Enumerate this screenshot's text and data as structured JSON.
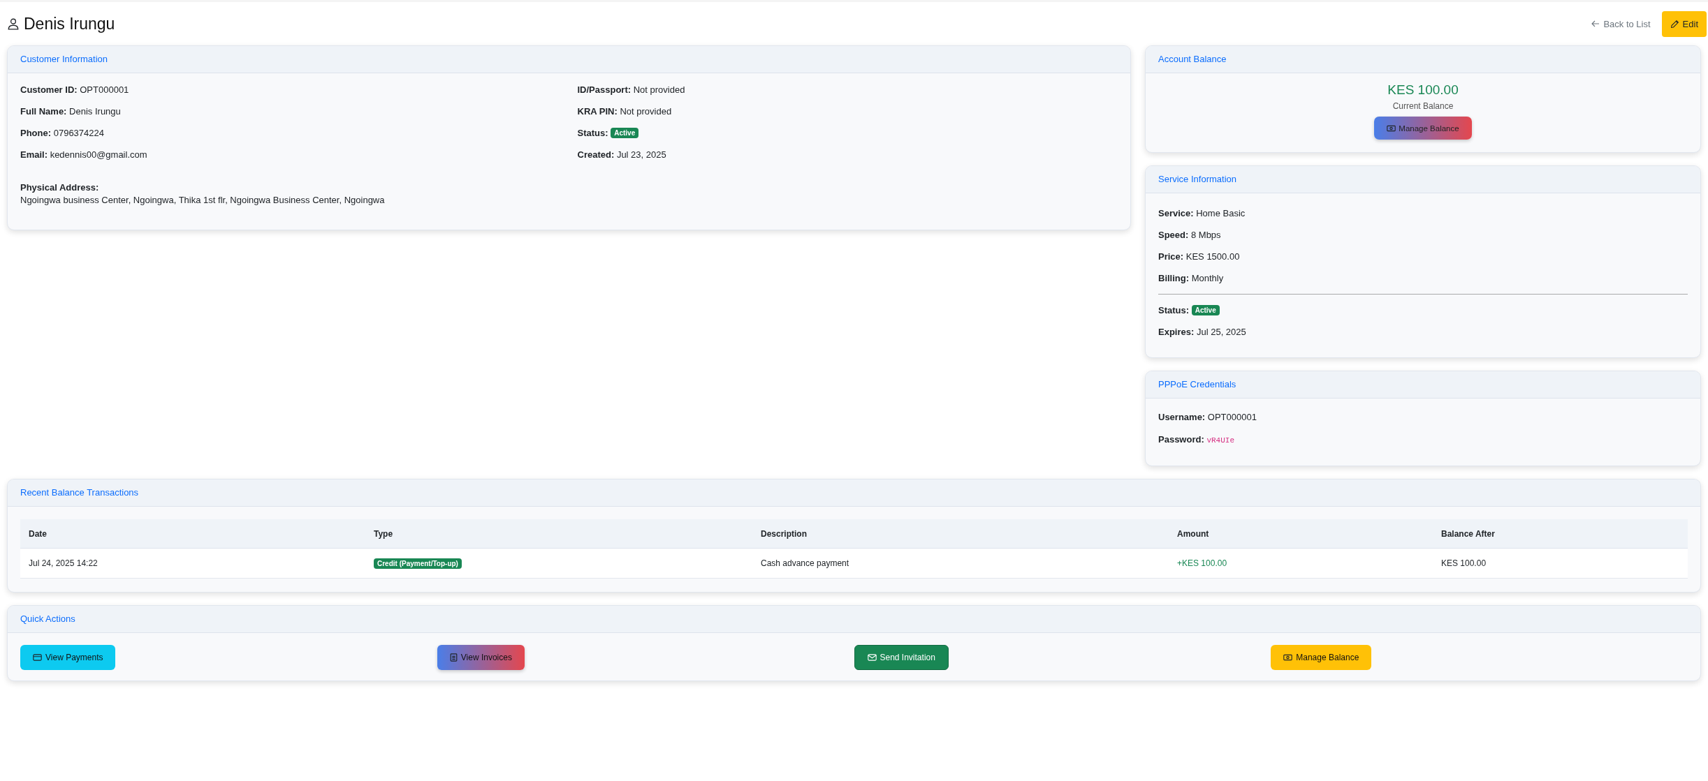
{
  "header": {
    "title": "Denis Irungu",
    "back_link": "Back to List",
    "edit_button": "Edit"
  },
  "customer_information": {
    "title": "Customer Information",
    "left_fields": [
      {
        "label": "Customer ID:",
        "value": "OPT000001",
        "kind": "text"
      },
      {
        "label": "Full Name:",
        "value": "Denis Irungu",
        "kind": "text"
      },
      {
        "label": "Phone:",
        "value": "0796374224",
        "kind": "text"
      },
      {
        "label": "Email:",
        "value": "kedennis00@gmail.com",
        "kind": "text"
      }
    ],
    "right_fields": [
      {
        "label": "ID/Passport:",
        "value": "Not provided",
        "kind": "text"
      },
      {
        "label": "KRA PIN:",
        "value": "Not provided",
        "kind": "text"
      },
      {
        "label": "Status:",
        "value": "Active",
        "kind": "badge"
      },
      {
        "label": "Created:",
        "value": "Jul 23, 2025",
        "kind": "text"
      }
    ],
    "address_label": "Physical Address:",
    "address": "Ngoingwa business Center, Ngoingwa, Thika 1st flr, Ngoingwa Business Center, Ngoingwa"
  },
  "account_balance": {
    "title": "Account Balance",
    "amount": "KES 100.00",
    "caption": "Current Balance",
    "button": "Manage Balance"
  },
  "service_information": {
    "title": "Service Information",
    "fields": [
      {
        "label": "Service:",
        "value": "Home Basic",
        "kind": "text"
      },
      {
        "label": "Speed:",
        "value": "8 Mbps",
        "kind": "text"
      },
      {
        "label": "Price:",
        "value": "KES 1500.00",
        "kind": "text"
      },
      {
        "label": "Billing:",
        "value": "Monthly",
        "kind": "text"
      }
    ],
    "status_fields": [
      {
        "label": "Status:",
        "value": "Active",
        "kind": "badge"
      },
      {
        "label": "Expires:",
        "value": "Jul 25, 2025",
        "kind": "text"
      }
    ]
  },
  "pppoe_credentials": {
    "title": "PPPoE Credentials",
    "fields": [
      {
        "label": "Username:",
        "value": "OPT000001",
        "kind": "text"
      },
      {
        "label": "Password:",
        "value": "vR4UIe",
        "kind": "code"
      }
    ]
  },
  "recent_balance_transactions": {
    "title": "Recent Balance Transactions",
    "columns": [
      "Date",
      "Type",
      "Description",
      "Amount",
      "Balance After"
    ],
    "rows": [
      [
        {
          "text": "Jul 24, 2025 14:22",
          "kind": "text"
        },
        {
          "text": "Credit (Payment/Top-up)",
          "kind": "badge"
        },
        {
          "text": "Cash advance payment",
          "kind": "text"
        },
        {
          "text": "+KES 100.00",
          "kind": "credit"
        },
        {
          "text": "KES 100.00",
          "kind": "text"
        }
      ]
    ]
  },
  "quick_actions": {
    "title": "Quick Actions",
    "buttons": [
      {
        "label": "View Payments",
        "kind": "info"
      },
      {
        "label": "View Invoices",
        "kind": "gradient"
      },
      {
        "label": "Send Invitation",
        "kind": "success"
      },
      {
        "label": "Manage Balance",
        "kind": "warning"
      }
    ]
  }
}
